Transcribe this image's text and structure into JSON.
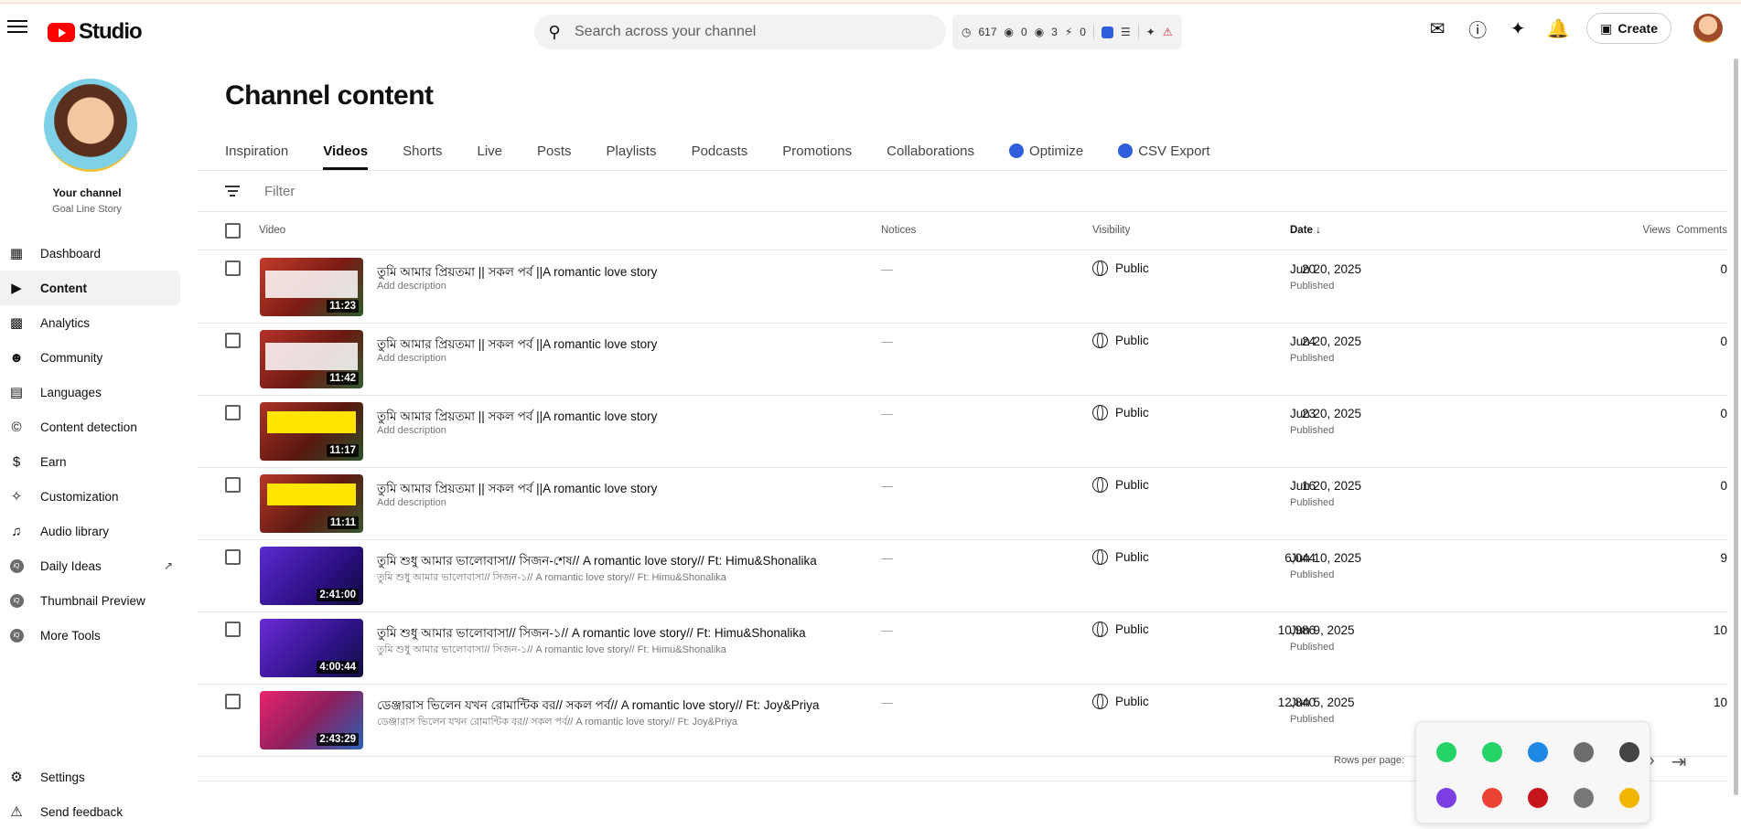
{
  "header": {
    "logo_text": "Studio",
    "search_placeholder": "Search across your channel",
    "stats": [
      "617",
      "0",
      "3",
      "0"
    ],
    "create_label": "Create"
  },
  "sidebar": {
    "channel_title": "Your channel",
    "channel_name": "Goal Line Story",
    "items": [
      {
        "label": "Dashboard",
        "icon": "dashboard-icon"
      },
      {
        "label": "Content",
        "icon": "content-icon"
      },
      {
        "label": "Analytics",
        "icon": "analytics-icon"
      },
      {
        "label": "Community",
        "icon": "community-icon"
      },
      {
        "label": "Languages",
        "icon": "subtitles-icon"
      },
      {
        "label": "Content detection",
        "icon": "copyright-icon"
      },
      {
        "label": "Earn",
        "icon": "dollar-icon"
      },
      {
        "label": "Customization",
        "icon": "magic-wand-icon"
      },
      {
        "label": "Audio library",
        "icon": "audio-library-icon"
      },
      {
        "label": "Daily Ideas",
        "icon": "vidiq-icon"
      },
      {
        "label": "Thumbnail Preview",
        "icon": "vidiq-icon"
      },
      {
        "label": "More Tools",
        "icon": "vidiq-icon"
      }
    ],
    "bottom": [
      {
        "label": "Settings",
        "icon": "gear-icon"
      },
      {
        "label": "Send feedback",
        "icon": "feedback-icon"
      }
    ]
  },
  "main": {
    "title": "Channel content",
    "tabs": [
      {
        "label": "Inspiration"
      },
      {
        "label": "Videos"
      },
      {
        "label": "Shorts"
      },
      {
        "label": "Live"
      },
      {
        "label": "Posts"
      },
      {
        "label": "Playlists"
      },
      {
        "label": "Podcasts"
      },
      {
        "label": "Promotions"
      },
      {
        "label": "Collaborations"
      },
      {
        "label": "Optimize"
      },
      {
        "label": "CSV Export"
      }
    ],
    "filter_placeholder": "Filter",
    "columns": {
      "video": "Video",
      "notices": "Notices",
      "visibility": "Visibility",
      "date": "Date",
      "views": "Views",
      "comments": "Comments"
    },
    "rows": [
      {
        "title": "তুমি আমার প্রিয়তমা || সকল পর্ব ||A romantic love story",
        "desc": "Add description",
        "duration": "11:23",
        "notice": "—",
        "visibility": "Public",
        "date": "Jun 20, 2025",
        "status": "Published",
        "views": "20",
        "comments": "0"
      },
      {
        "title": "তুমি আমার প্রিয়তমা || সকল পর্ব ||A romantic love story",
        "desc": "Add description",
        "duration": "11:42",
        "notice": "—",
        "visibility": "Public",
        "date": "Jun 20, 2025",
        "status": "Published",
        "views": "24",
        "comments": "0"
      },
      {
        "title": "তুমি আমার প্রিয়তমা || সকল পর্ব ||A romantic love story",
        "desc": "Add description",
        "duration": "11:17",
        "notice": "—",
        "visibility": "Public",
        "date": "Jun 20, 2025",
        "status": "Published",
        "views": "23",
        "comments": "0"
      },
      {
        "title": "তুমি আমার প্রিয়তমা || সকল পর্ব ||A romantic love story",
        "desc": "Add description",
        "duration": "11:11",
        "notice": "—",
        "visibility": "Public",
        "date": "Jun 20, 2025",
        "status": "Published",
        "views": "16",
        "comments": "0"
      },
      {
        "title": "তুমি শুধু আমার ভালোবাসা// সিজন-শেষ// A romantic love story// Ft: Himu&Shonalika",
        "desc": "তুমি শুধু আমার ভালোবাসা// সিজন-১// A romantic love story// Ft: Himu&Shonalika",
        "duration": "2:41:00",
        "notice": "—",
        "visibility": "Public",
        "date": "Jun 10, 2025",
        "status": "Published",
        "views": "6,044",
        "comments": "9"
      },
      {
        "title": "তুমি শুধু আমার ভালোবাসা// সিজন-১// A romantic love story// Ft: Himu&Shonalika",
        "desc": "তুমি শুধু আমার ভালোবাসা// সিজন-১// A romantic love story// Ft: Himu&Shonalika",
        "duration": "4:00:44",
        "notice": "—",
        "visibility": "Public",
        "date": "Jun 9, 2025",
        "status": "Published",
        "views": "10,986",
        "comments": "10"
      },
      {
        "title": "ডেঞ্জারাস ভিলেন যখন রোমান্টিক বর// সকল পর্ব// A romantic love story// Ft: Joy&Priya",
        "desc": "ডেঞ্জারাস ভিলেন যখন রোমান্টিক বর// সকল পর্ব// A romantic love story// Ft: Joy&Priya",
        "duration": "2:43:29",
        "notice": "—",
        "visibility": "Public",
        "date": "Jun 5, 2025",
        "status": "Published",
        "views": "12,840",
        "comments": "10"
      }
    ],
    "rows_per_page_label": "Rows per page:"
  },
  "tray": {
    "icons": [
      "whatsapp-icon",
      "whatsapp-icon",
      "edge-icon",
      "webcam-icon",
      "cloud-info-icon",
      "feather-icon",
      "chrome-icon",
      "app-icon",
      "usb-icon",
      "warning-shield-icon"
    ]
  },
  "colors": {
    "accent": "#ff0000",
    "vidiq": "#2e5ede",
    "tab_active": "#0f0f0f"
  }
}
